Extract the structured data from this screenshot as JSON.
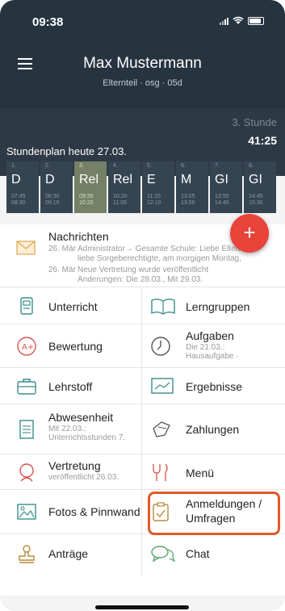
{
  "status": {
    "time": "09:38"
  },
  "header": {
    "user_name": "Max Mustermann",
    "user_role": "Elternteil · osg · 05d",
    "next_label": "3. Stunde",
    "countdown": "41:25",
    "timetable_title": "Stundenplan heute 27.03."
  },
  "timetable": [
    {
      "num": "1.",
      "subject": "D",
      "start": "07:45",
      "end": "08:30"
    },
    {
      "num": "2.",
      "subject": "D",
      "start": "08:30",
      "end": "09:15"
    },
    {
      "num": "3.",
      "subject": "Rel",
      "start": "09:35",
      "end": "10:20"
    },
    {
      "num": "4.",
      "subject": "Rel",
      "start": "10:20",
      "end": "11:05"
    },
    {
      "num": "5.",
      "subject": "E",
      "start": "11:25",
      "end": "12:10"
    },
    {
      "num": "6.",
      "subject": "M",
      "start": "13:05",
      "end": "13:50"
    },
    {
      "num": "7.",
      "subject": "GI",
      "start": "13:55",
      "end": "14:40"
    },
    {
      "num": "8.",
      "subject": "GI",
      "start": "14:45",
      "end": "15:30"
    }
  ],
  "current_period_index": 2,
  "fab": {
    "label": "+"
  },
  "news": {
    "title": "Nachrichten",
    "items": [
      {
        "date": "26. Mär",
        "line1": "Administrator→ Gesamte Schule: Liebe Eltern,",
        "line2": "liebe Sorgeberechtigte, am morgigen Montag,"
      },
      {
        "date": "26. Mär",
        "line1": "Neue Vertretung wurde veröffentlicht",
        "line2": "Änderungen: Die 28.03., Mit 29.03."
      }
    ]
  },
  "tiles": {
    "unterricht": "Unterricht",
    "lerngruppen": "Lerngruppen",
    "bewertung": "Bewertung",
    "aufgaben": "Aufgaben",
    "aufgaben_sub1": "Die 21.03.:",
    "aufgaben_sub2": "Hausaufgabe ·",
    "lehrstoff": "Lehrstoff",
    "ergebnisse": "Ergebnisse",
    "abwesenheit": "Abwesenheit",
    "abwesenheit_sub1": "Mit 22.03.:",
    "abwesenheit_sub2": "Unterrichtsstunden 7.",
    "zahlungen": "Zahlungen",
    "vertretung": "Vertretung",
    "vertretung_sub": "veröffentlicht 26.03.",
    "menu": "Menü",
    "fotos": "Fotos & Pinnwand",
    "anmeldungen1": "Anmeldungen /",
    "anmeldungen2": "Umfragen",
    "antraege": "Anträge",
    "chat": "Chat"
  },
  "colors": {
    "header_bg": "#263440",
    "current_period": "#758066",
    "fab": "#e8443a",
    "highlight": "#e05a28",
    "icon_teal": "#3a8c8c"
  }
}
